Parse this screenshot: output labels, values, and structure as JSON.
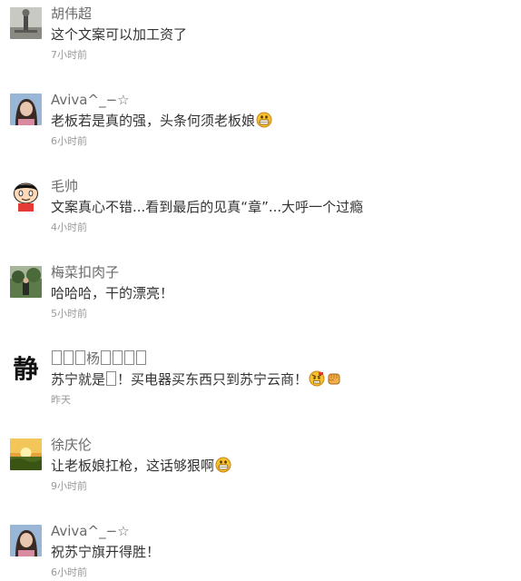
{
  "comments": [
    {
      "user": "胡伟超",
      "text": "这个文案可以加工资了",
      "time": "7小时前"
    },
    {
      "user": "Aviva^_−☆",
      "text": "老板若是真的强，头条何须老板娘",
      "emoji": "grin-face",
      "time": "6小时前"
    },
    {
      "user": "毛帅",
      "text": "文案真心不错...看到最后的见真“章”...大呼一个过瘾",
      "time": "4小时前"
    },
    {
      "user": "梅菜扣肉子",
      "text": "哈哈哈，干的漂亮！",
      "time": "5小时前"
    },
    {
      "user_pre": "",
      "user_mid": "杨",
      "user_post": "",
      "text_pre": "苏宁就是",
      "text_post": "！买电器买东西只到苏宁云商！",
      "emoji1": "determined-face",
      "emoji2": "fist",
      "time": "昨天"
    },
    {
      "user": "徐庆伦",
      "text": "让老板娘扛枪，这话够狠啊",
      "emoji": "grin-face",
      "time": "9小时前"
    },
    {
      "user": "Aviva^_−☆",
      "text": "祝苏宁旗开得胜！",
      "time": "6小时前"
    }
  ],
  "avatar_glyph": "静"
}
